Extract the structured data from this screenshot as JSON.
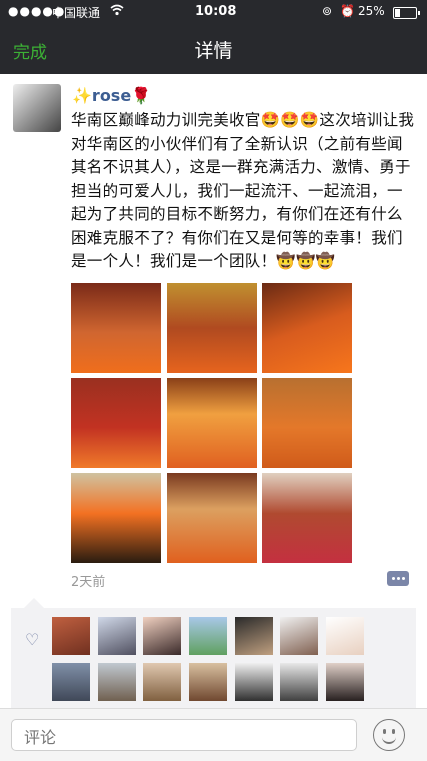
{
  "status_bar": {
    "signal": "●●●●●",
    "carrier": "中国联通",
    "time": "10:08",
    "battery_percent": "25%",
    "battery_level": 0.25
  },
  "nav": {
    "back_label": "完成",
    "title": "详情"
  },
  "post": {
    "author": "rose",
    "author_prefix_emoji": "✨",
    "author_suffix_emoji": "🌹",
    "text": "华南区巅峰动力训完美收官🤩🤩🤩这次培训让我对华南区的小伙伴们有了全新认识（之前有些闻其名不识其人），这是一群充满活力、激情、勇于担当的可爱人儿，我们一起流汗、一起流泪，一起为了共同的目标不断努力，有你们在还有什么困难克服不了？有你们在又是何等的幸事！我们是一个人！我们是一个团队！🤠🤠🤠",
    "photo_count": 9,
    "time_ago": "2天前"
  },
  "likes": {
    "count": 14
  },
  "comment_bar": {
    "placeholder": "评论"
  },
  "icons": {
    "wifi": "wifi-icon",
    "alarm": "alarm-icon",
    "lock": "rotation-lock-icon",
    "heart": "heart-icon",
    "comment": "comment-icon",
    "emoji": "emoji-icon"
  },
  "colors": {
    "accent_green": "#3cb035",
    "name_blue": "#3d5e92",
    "nav_bg": "#28292d"
  }
}
